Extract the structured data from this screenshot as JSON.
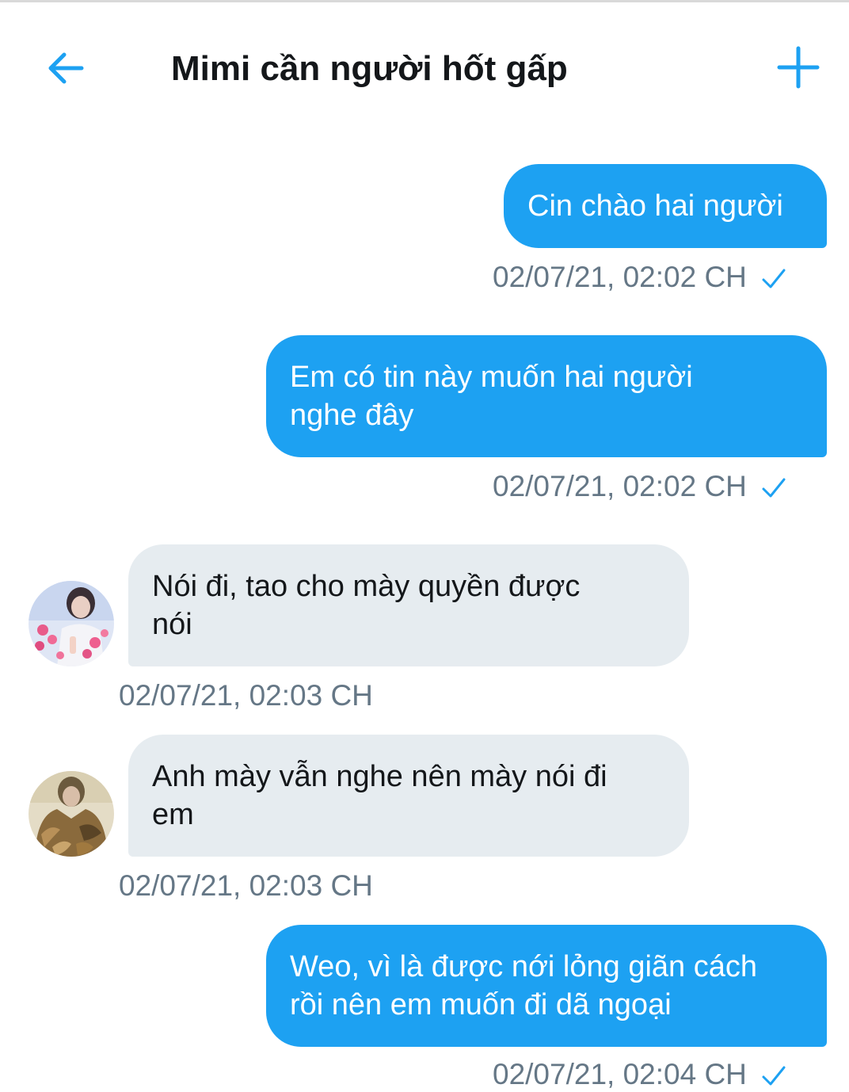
{
  "header": {
    "title": "Mimi cần người hốt gấp",
    "back_icon": "arrow-left-icon",
    "add_icon": "plus-icon",
    "accent_color": "#1da1f2"
  },
  "messages": [
    {
      "direction": "outgoing",
      "lines": [
        "Cin chào hai người"
      ],
      "timestamp": "02/07/21, 02:02 CH",
      "read_icon": "checkmark-icon"
    },
    {
      "direction": "outgoing",
      "lines": [
        "Em có tin này muốn hai người",
        "nghe đây"
      ],
      "timestamp": "02/07/21, 02:02 CH",
      "read_icon": "checkmark-icon"
    },
    {
      "direction": "incoming",
      "lines": [
        "Nói đi, tao cho mày quyền được",
        "nói"
      ],
      "timestamp": "02/07/21, 02:03 CH",
      "avatar_icon": "avatar-pink-hearts"
    },
    {
      "direction": "incoming",
      "lines": [
        "Anh mày vẫn nghe nên mày nói đi",
        "em"
      ],
      "timestamp": "02/07/21, 02:03 CH",
      "avatar_icon": "avatar-fur-coat"
    },
    {
      "direction": "outgoing",
      "lines": [
        "Weo, vì là được nới lỏng giãn cách",
        "rồi nên em muốn đi dã ngoại"
      ],
      "timestamp": "02/07/21, 02:04 CH",
      "read_icon": "checkmark-icon"
    }
  ]
}
